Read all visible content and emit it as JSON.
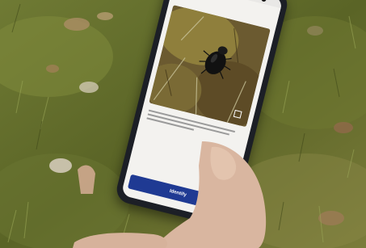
{
  "screen": {
    "app_title": "",
    "caption": "",
    "button_label": "Identify"
  },
  "colors": {
    "grass_dark": "#4f5a22",
    "grass_light": "#8c8f45",
    "phone_body": "#1c1f26",
    "button": "#1f3a93",
    "skin": "#d9b6a0"
  }
}
